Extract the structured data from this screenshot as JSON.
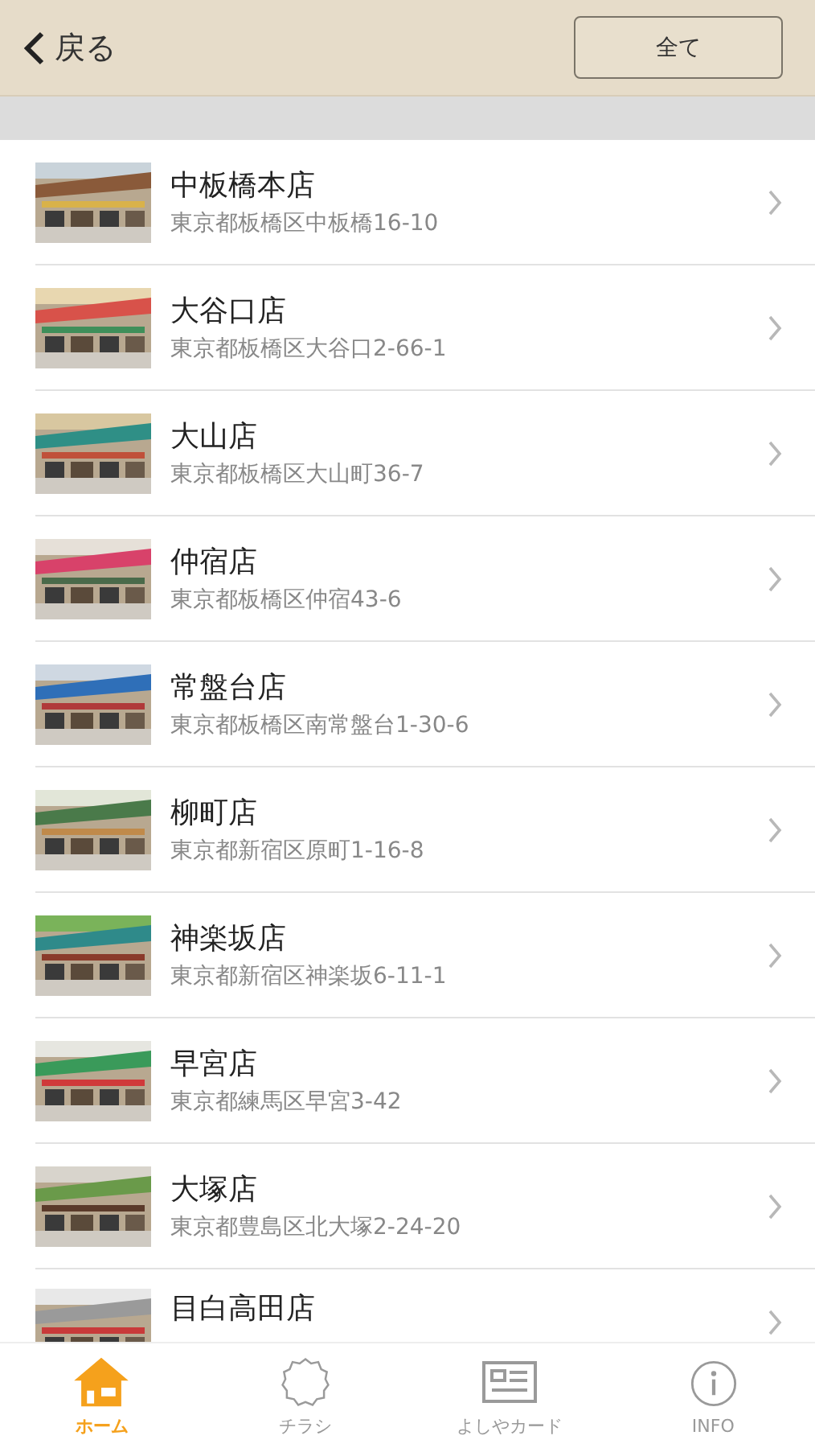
{
  "header": {
    "back": "戻る",
    "all_button": "全て"
  },
  "stores": [
    {
      "name": "中板橋本店",
      "address": "東京都板橋区中板橋16-10"
    },
    {
      "name": "大谷口店",
      "address": "東京都板橋区大谷口2-66-1"
    },
    {
      "name": "大山店",
      "address": "東京都板橋区大山町36-7"
    },
    {
      "name": "仲宿店",
      "address": "東京都板橋区仲宿43-6"
    },
    {
      "name": "常盤台店",
      "address": "東京都板橋区南常盤台1-30-6"
    },
    {
      "name": "柳町店",
      "address": "東京都新宿区原町1-16-8"
    },
    {
      "name": "神楽坂店",
      "address": "東京都新宿区神楽坂6-11-1"
    },
    {
      "name": "早宮店",
      "address": "東京都練馬区早宮3-42"
    },
    {
      "name": "大塚店",
      "address": "東京都豊島区北大塚2-24-20"
    },
    {
      "name": "目白高田店"
    }
  ],
  "tabs": [
    {
      "kind": "home",
      "label": "ホーム",
      "selected": true
    },
    {
      "kind": "flyer",
      "label": "チラシ",
      "selected": false
    },
    {
      "kind": "card",
      "label": "よしやカード",
      "selected": false
    },
    {
      "kind": "info",
      "label": "INFO",
      "selected": false
    }
  ]
}
